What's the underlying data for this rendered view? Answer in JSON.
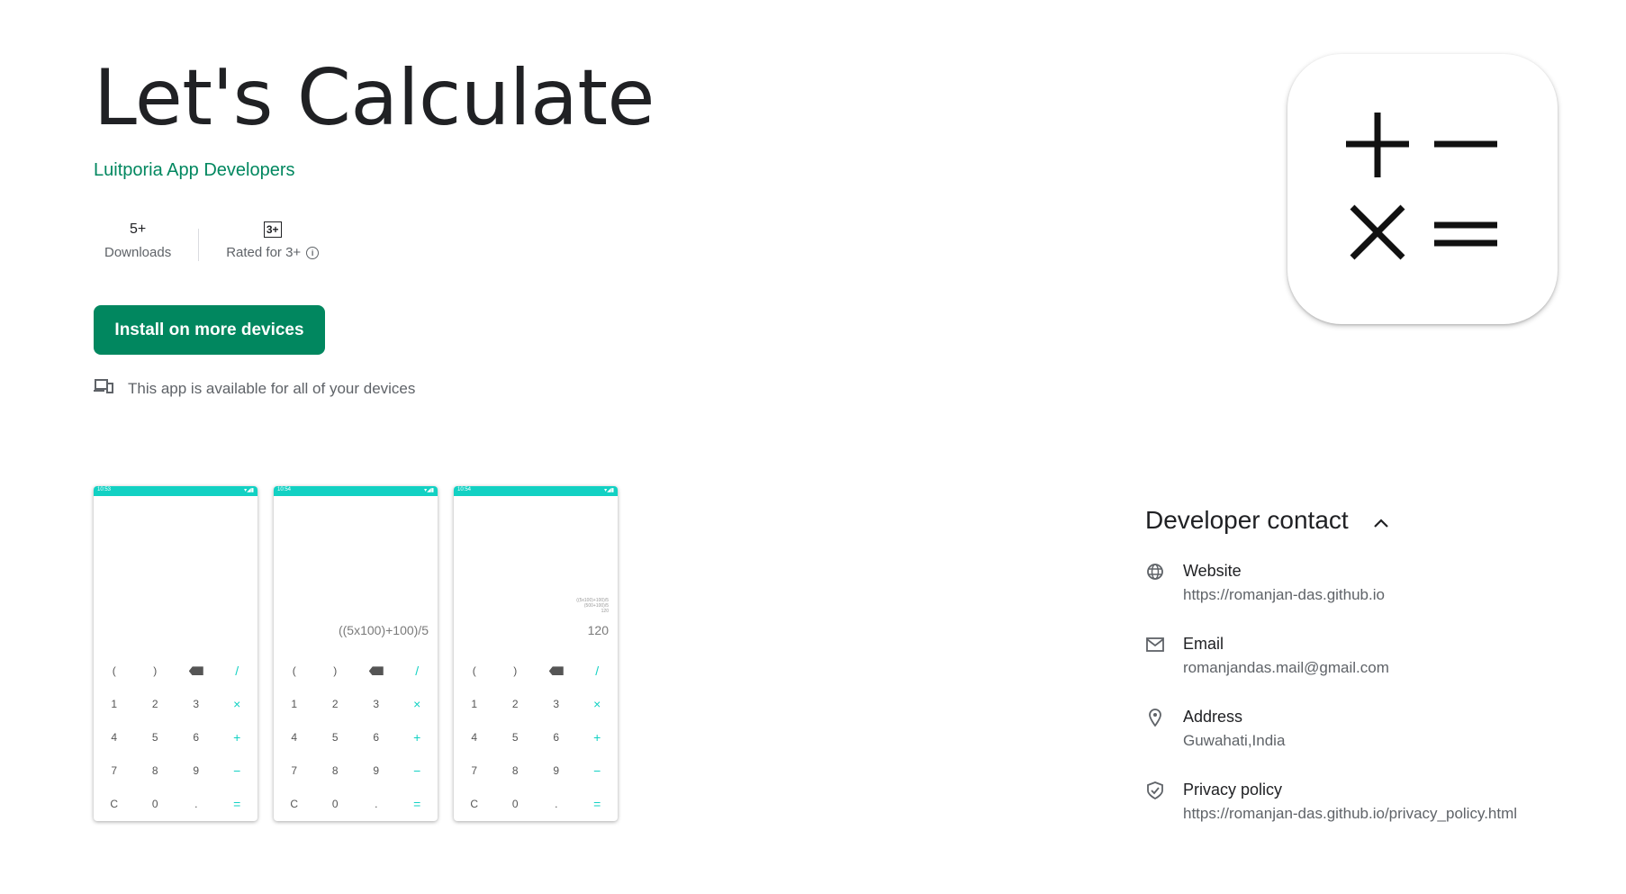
{
  "app": {
    "title": "Let's Calculate",
    "developer": "Luitporia App Developers"
  },
  "stats": {
    "downloads_value": "5+",
    "downloads_label": "Downloads",
    "rating_badge": "3+",
    "rating_label": "Rated for 3+"
  },
  "install": {
    "label": "Install on more devices"
  },
  "availability": {
    "text": "This app is available for all of your devices"
  },
  "screenshots": [
    {
      "time": "10:53",
      "expression": "",
      "history": "",
      "result": ""
    },
    {
      "time": "10:54",
      "expression": "((5x100)+100)/5",
      "history": "",
      "result": ""
    },
    {
      "time": "10:54",
      "expression": "",
      "history": "((5x100)+100)/5\n(500+100)/5\n120",
      "result": "120"
    }
  ],
  "keypad": {
    "row1": [
      "(",
      ")",
      "⌫",
      "/"
    ],
    "row2": [
      "1",
      "2",
      "3",
      "×"
    ],
    "row3": [
      "4",
      "5",
      "6",
      "+"
    ],
    "row4": [
      "7",
      "8",
      "9",
      "−"
    ],
    "row5": [
      "C",
      "0",
      ".",
      "="
    ]
  },
  "developer_contact": {
    "title": "Developer contact",
    "website_label": "Website",
    "website_value": "https://romanjan-das.github.io",
    "email_label": "Email",
    "email_value": "romanjandas.mail@gmail.com",
    "address_label": "Address",
    "address_value": "Guwahati,India",
    "privacy_label": "Privacy policy",
    "privacy_value": "https://romanjan-das.github.io/privacy_policy.html"
  },
  "colors": {
    "brand_green": "#01875f",
    "accent_teal": "#12d1c3"
  }
}
